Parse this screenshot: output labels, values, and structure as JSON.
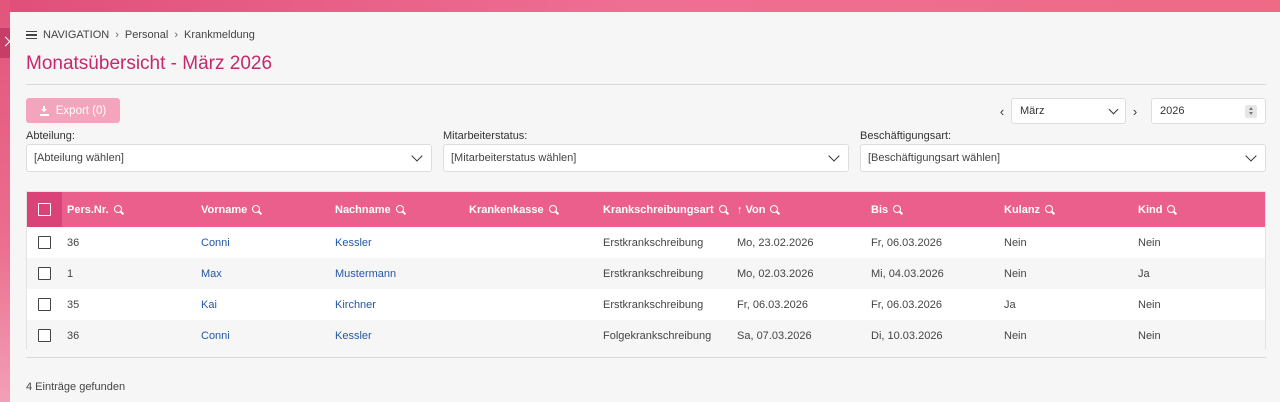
{
  "breadcrumb": {
    "nav": "NAVIGATION",
    "items": [
      "Personal",
      "Krankmeldung"
    ]
  },
  "title": "Monatsübersicht - März 2026",
  "toolbar": {
    "export_label": "Export (0)",
    "month": "März",
    "year": "2026"
  },
  "filters": [
    {
      "label": "Abteilung:",
      "value": "[Abteilung wählen]"
    },
    {
      "label": "Mitarbeiterstatus:",
      "value": "[Mitarbeiterstatus wählen]"
    },
    {
      "label": "Beschäftigungsart:",
      "value": "[Beschäftigungsart wählen]"
    }
  ],
  "table": {
    "columns": [
      "Pers.Nr.",
      "Vorname",
      "Nachname",
      "Krankenkasse",
      "Krankschreibungsart",
      "Von",
      "Bis",
      "Kulanz",
      "Kind"
    ],
    "sorted_column": "Von",
    "rows": [
      {
        "persnr": "36",
        "vorname": "Conni",
        "nachname": "Kessler",
        "krankenkasse": "",
        "art": "Erstkrankschreibung",
        "von": "Mo, 23.02.2026",
        "bis": "Fr, 06.03.2026",
        "kulanz": "Nein",
        "kind": "Nein"
      },
      {
        "persnr": "1",
        "vorname": "Max",
        "nachname": "Mustermann",
        "krankenkasse": "",
        "art": "Erstkrankschreibung",
        "von": "Mo, 02.03.2026",
        "bis": "Mi, 04.03.2026",
        "kulanz": "Nein",
        "kind": "Ja"
      },
      {
        "persnr": "35",
        "vorname": "Kai",
        "nachname": "Kirchner",
        "krankenkasse": "",
        "art": "Erstkrankschreibung",
        "von": "Fr, 06.03.2026",
        "bis": "Fr, 06.03.2026",
        "kulanz": "Ja",
        "kind": "Nein"
      },
      {
        "persnr": "36",
        "vorname": "Conni",
        "nachname": "Kessler",
        "krankenkasse": "",
        "art": "Folgekrankschreibung",
        "von": "Sa, 07.03.2026",
        "bis": "Di, 10.03.2026",
        "kulanz": "Nein",
        "kind": "Nein"
      }
    ]
  },
  "footer": {
    "count_text": "4 Einträge gefunden"
  },
  "colors": {
    "accent": "#c5286b",
    "header": "#eb5f8d",
    "link": "#2458a6"
  }
}
